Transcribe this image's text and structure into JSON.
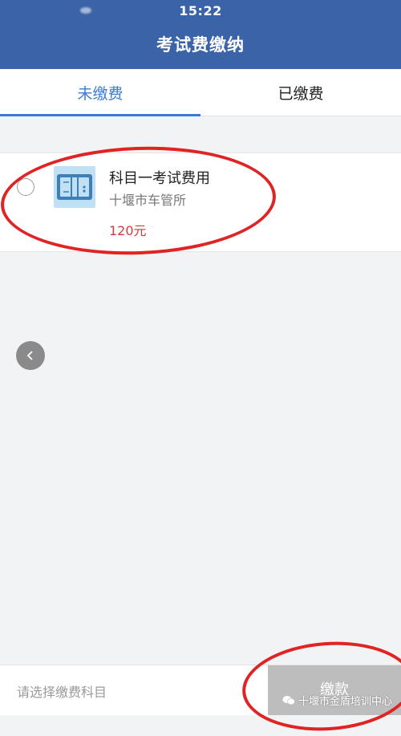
{
  "status_bar": {
    "time": "15:22"
  },
  "header": {
    "title": "考试费缴纳"
  },
  "tabs": [
    {
      "label": "未缴费",
      "active": true
    },
    {
      "label": "已缴费",
      "active": false
    }
  ],
  "fee_item": {
    "title": "科目一考试费用",
    "organization": "十堰市车管所",
    "amount": "120元",
    "icon": "document-icon",
    "selected": false
  },
  "bottom_bar": {
    "hint": "请选择缴费科目",
    "pay_label": "缴款"
  },
  "watermark": {
    "text": "十堰市金盾培训中心"
  },
  "colors": {
    "header_bg": "#3a63a8",
    "accent": "#3a7bd5",
    "amount": "#d03c3c",
    "annotation": "#e02323",
    "pay_disabled": "#bdbdbd"
  }
}
